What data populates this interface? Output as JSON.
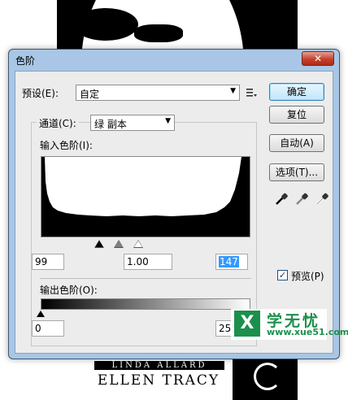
{
  "background": {
    "brand_line1": "LINDA ALLARD",
    "brand_line2": "ELLEN TRACY"
  },
  "dialog": {
    "title": "色阶",
    "close_glyph": "✕"
  },
  "preset": {
    "label": "预设(E):",
    "value": "自定",
    "options_icon": "preset-options-icon"
  },
  "channel": {
    "label": "通道(C):",
    "value": "绿 副本"
  },
  "input_levels": {
    "label": "输入色阶(I):",
    "black": "99",
    "gamma": "1.00",
    "white": "147"
  },
  "output_levels": {
    "label": "输出色阶(O):",
    "black": "0",
    "white": "255"
  },
  "buttons": {
    "ok": "确定",
    "reset": "复位",
    "auto": "自动(A)",
    "options": "选项(T)..."
  },
  "eyedroppers": [
    "black-eyedropper-icon",
    "gray-eyedropper-icon",
    "white-eyedropper-icon"
  ],
  "preview": {
    "label": "预览(P)",
    "checked": true
  },
  "watermark": {
    "logo_glyph": "X",
    "text": "学无忧",
    "url": "www.xue51.com"
  }
}
